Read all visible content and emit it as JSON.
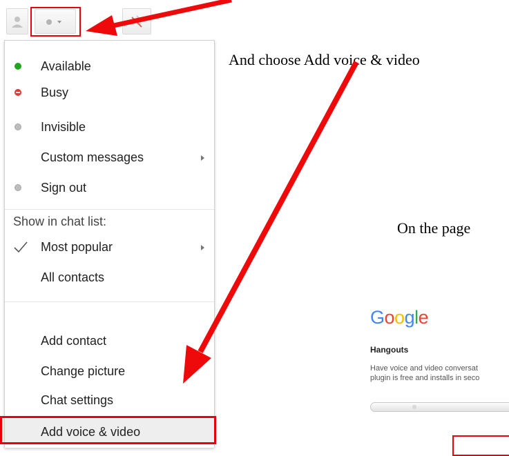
{
  "toolbar": {
    "user_icon": "person-icon",
    "status_icon": "status-dot-icon",
    "dropdown_icon": "chevron-down-icon",
    "phone_icon": "phone-off-icon"
  },
  "menu": {
    "status_items": [
      {
        "label": "Available",
        "dot_color": "#1fa51f"
      },
      {
        "label": "Busy",
        "dot_color": "#e53935"
      },
      {
        "label": "Invisible",
        "dot_color": "#bdbdbd"
      },
      {
        "label": "Custom messages"
      },
      {
        "label": "Sign out",
        "dot_color": "#bdbdbd"
      }
    ],
    "show_header": "Show in chat list:",
    "list_items": [
      {
        "label": "Most popular",
        "checked": true
      },
      {
        "label": "All contacts"
      }
    ],
    "action_items": [
      {
        "label": "Add contact"
      },
      {
        "label": "Change picture"
      },
      {
        "label": "Chat settings"
      },
      {
        "label": "Add voice & video"
      }
    ]
  },
  "instructions": {
    "step1": "And choose Add voice & video",
    "step2": "On the page"
  },
  "hangouts_page": {
    "logo_letters": [
      {
        "char": "G",
        "color": "#4285f4"
      },
      {
        "char": "o",
        "color": "#ea4335"
      },
      {
        "char": "o",
        "color": "#fbbc05"
      },
      {
        "char": "g",
        "color": "#4285f4"
      },
      {
        "char": "l",
        "color": "#34a853"
      },
      {
        "char": "e",
        "color": "#ea4335"
      }
    ],
    "title": "Hangouts",
    "description_line1": "Have voice and video conversat",
    "description_line2": "plugin is free and installs in seco"
  },
  "colors": {
    "highlight": "#e8000b",
    "arrow": "#ee0a0a"
  }
}
